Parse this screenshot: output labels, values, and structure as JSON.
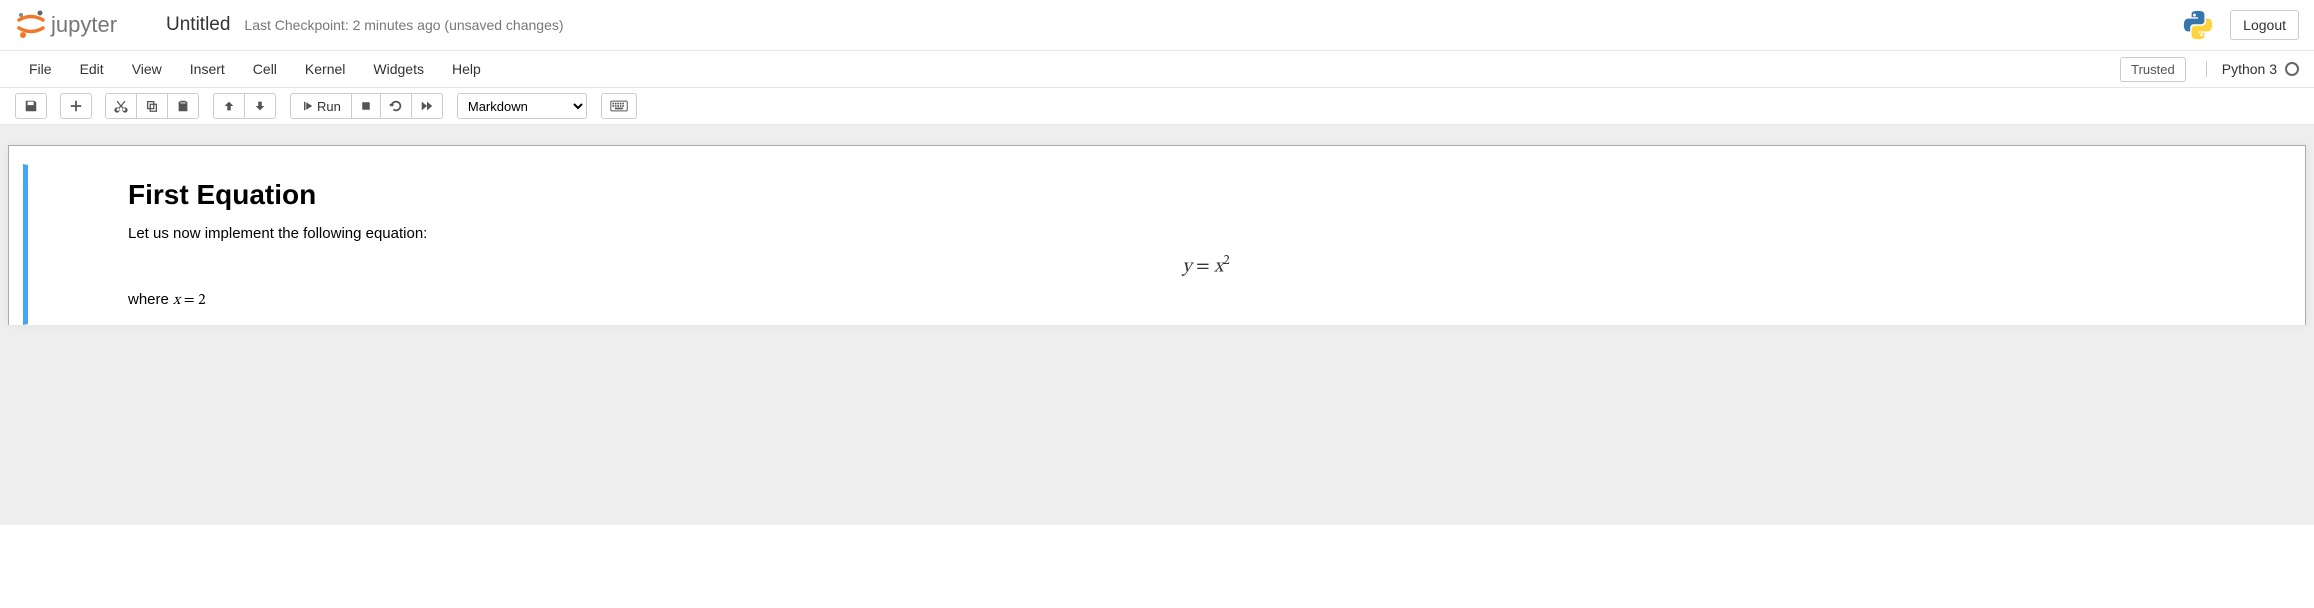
{
  "header": {
    "notebook_name": "Untitled",
    "checkpoint_prefix": "Last Checkpoint: ",
    "checkpoint_time": "2 minutes ago",
    "unsaved": "  (unsaved changes)",
    "logout": "Logout"
  },
  "menu": {
    "items": [
      "File",
      "Edit",
      "View",
      "Insert",
      "Cell",
      "Kernel",
      "Widgets",
      "Help"
    ],
    "trusted": "Trusted",
    "kernel": "Python 3"
  },
  "toolbar": {
    "run_label": "Run",
    "cell_type_selected": "Markdown"
  },
  "cell": {
    "heading": "First Equation",
    "intro": "Let us now implement the following equation:",
    "where_prefix": "where ",
    "where_var": "x",
    "where_eq": " = ",
    "where_val": "2",
    "eq_lhs": "y",
    "eq_eqs": " = ",
    "eq_rhs_base": "x",
    "eq_rhs_exp": "2"
  }
}
